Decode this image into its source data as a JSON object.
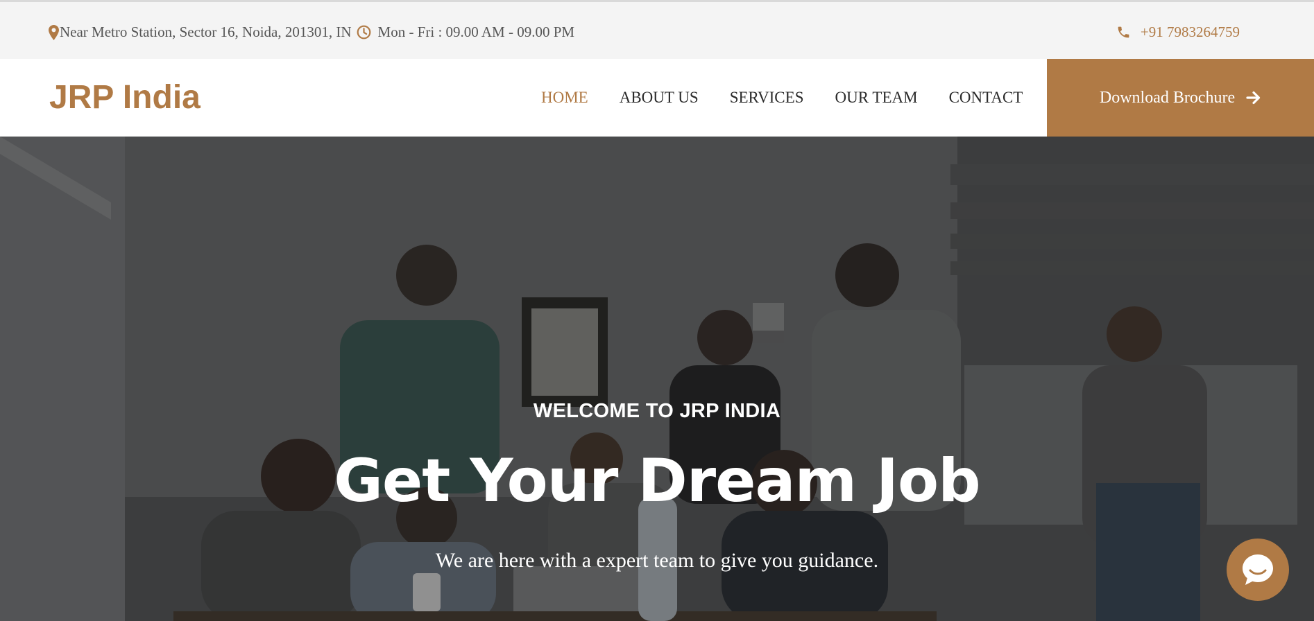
{
  "topbar": {
    "address": "Near Metro Station, Sector 16, Noida, 201301, IN",
    "hours": "Mon - Fri : 09.00 AM - 09.00 PM",
    "phone": "+91 7983264759"
  },
  "navbar": {
    "logo": "JRP India",
    "menu": [
      {
        "label": "HOME"
      },
      {
        "label": "ABOUT US"
      },
      {
        "label": "SERVICES"
      },
      {
        "label": "OUR TEAM"
      },
      {
        "label": "CONTACT"
      }
    ],
    "cta_label": "Download Brochure"
  },
  "hero": {
    "eyebrow": "WELCOME TO JRP INDIA",
    "headline": "Get Your Dream Job",
    "tagline": "We are here with a expert team to give you guidance."
  },
  "colors": {
    "accent": "#b07a45",
    "topbar_bg": "#f4f4f4",
    "nav_text": "#2b2b2b",
    "hero_overlay": "#3c3d3f"
  },
  "icons": {
    "address": "map-pin-icon",
    "hours": "clock-icon",
    "phone": "phone-icon",
    "cta": "arrow-right-icon",
    "chat": "chat-bubble-icon"
  }
}
